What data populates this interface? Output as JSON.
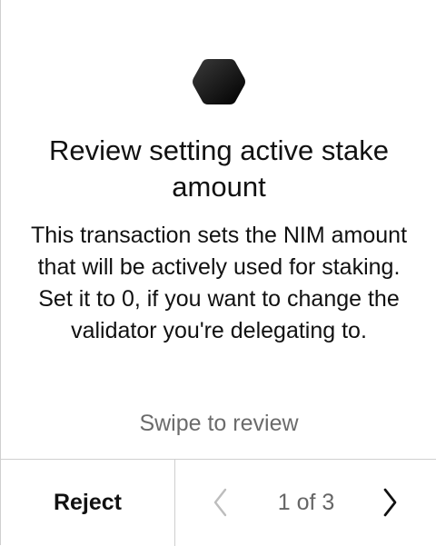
{
  "screen": {
    "title": "Review setting active stake amount",
    "description": "This transaction sets the NIM amount that will be actively used for staking. Set it to 0, if you want to change the validator you're delegating to.",
    "hint": "Swipe to review",
    "logo_icon": "nimiq-hexagon-icon"
  },
  "footer": {
    "reject_label": "Reject",
    "page_indicator": "1 of 3",
    "prev_icon": "chevron-left-icon",
    "next_icon": "chevron-right-icon"
  },
  "colors": {
    "text": "#111111",
    "muted_text": "#6b6b6b",
    "divider": "#cfcfcf",
    "disabled_chevron": "#bdbdbd",
    "logo": "#000000"
  }
}
